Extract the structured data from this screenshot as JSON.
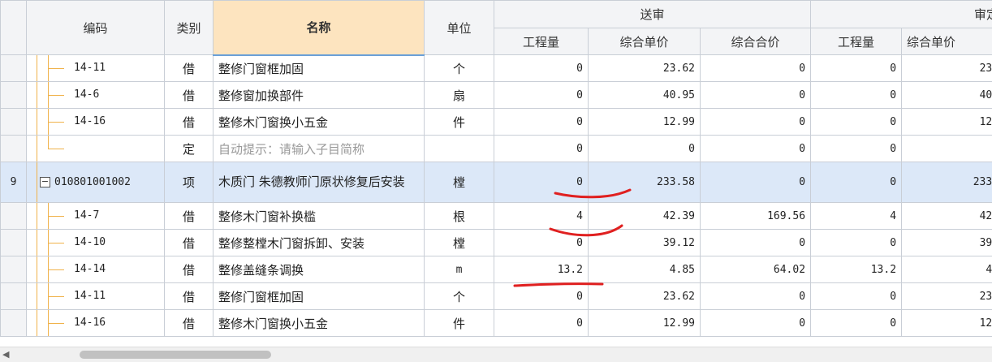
{
  "headers": {
    "code": "编码",
    "type": "类别",
    "name": "名称",
    "unit": "单位",
    "group_submit": "送审",
    "group_approve": "审定",
    "qty": "工程量",
    "unit_price": "综合单价",
    "total_price": "综合合价",
    "qty2": "工程量",
    "unit_price2": "综合单价"
  },
  "rows": [
    {
      "num": "",
      "code": "14-11",
      "type": "借",
      "name": "整修门窗框加固",
      "unit": "个",
      "qty": "0",
      "price": "23.62",
      "total": "0",
      "qty2": "0",
      "price2": "23."
    },
    {
      "num": "",
      "code": "14-6",
      "type": "借",
      "name": "整修窗加换部件",
      "unit": "扇",
      "qty": "0",
      "price": "40.95",
      "total": "0",
      "qty2": "0",
      "price2": "40."
    },
    {
      "num": "",
      "code": "14-16",
      "type": "借",
      "name": "整修木门窗换小五金",
      "unit": "件",
      "qty": "0",
      "price": "12.99",
      "total": "0",
      "qty2": "0",
      "price2": "12."
    },
    {
      "num": "",
      "code": "",
      "type": "定",
      "name": "自动提示：请输入子目简称",
      "unit": "",
      "qty": "0",
      "price": "0",
      "total": "0",
      "qty2": "0",
      "price2": ""
    },
    {
      "num": "9",
      "code": "010801001002",
      "type": "项",
      "name": "木质门 朱德教师门原状修复后安装",
      "unit": "樘",
      "qty": "0",
      "price": "233.58",
      "total": "0",
      "qty2": "0",
      "price2": "233."
    },
    {
      "num": "",
      "code": "14-7",
      "type": "借",
      "name": "整修木门窗补换槛",
      "unit": "根",
      "qty": "4",
      "price": "42.39",
      "total": "169.56",
      "qty2": "4",
      "price2": "42."
    },
    {
      "num": "",
      "code": "14-10",
      "type": "借",
      "name": "整修整樘木门窗拆卸、安装",
      "unit": "樘",
      "qty": "0",
      "price": "39.12",
      "total": "0",
      "qty2": "0",
      "price2": "39."
    },
    {
      "num": "",
      "code": "14-14",
      "type": "借",
      "name": "整修盖缝条调换",
      "unit": "m",
      "qty": "13.2",
      "price": "4.85",
      "total": "64.02",
      "qty2": "13.2",
      "price2": "4."
    },
    {
      "num": "",
      "code": "14-11",
      "type": "借",
      "name": "整修门窗框加固",
      "unit": "个",
      "qty": "0",
      "price": "23.62",
      "total": "0",
      "qty2": "0",
      "price2": "23."
    },
    {
      "num": "",
      "code": "14-16",
      "type": "借",
      "name": "整修木门窗换小五金",
      "unit": "件",
      "qty": "0",
      "price": "12.99",
      "total": "0",
      "qty2": "0",
      "price2": "12."
    }
  ],
  "collapse_symbol": "−",
  "scroll_left": "◀"
}
